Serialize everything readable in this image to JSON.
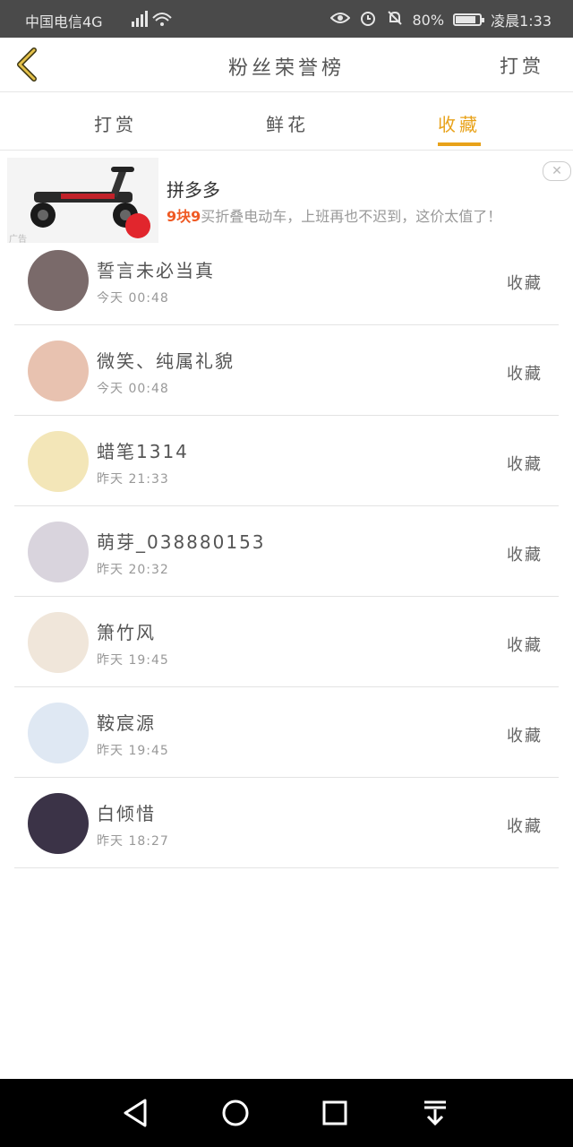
{
  "status_bar": {
    "carrier": "中国电信4G",
    "network": "4G",
    "battery": "80%",
    "time": "凌晨1:33",
    "icons": [
      "signal-icon",
      "wifi-icon",
      "eye-icon",
      "alarm-icon",
      "mute-bell-icon",
      "battery-icon"
    ]
  },
  "header": {
    "title": "粉丝荣誉榜",
    "right_action": "打赏"
  },
  "tabs": [
    {
      "label": "打赏"
    },
    {
      "label": "鲜花"
    },
    {
      "label": "收藏",
      "active": true
    }
  ],
  "ad": {
    "title": "拼多多",
    "highlight": "9块9",
    "desc_rest": "买折叠电动车，上班再也不迟到，这价太值了！",
    "badge": "广告",
    "close": "✕"
  },
  "list": [
    {
      "name": "誓言未必当真",
      "time": "今天 00:48",
      "action": "收藏",
      "avatar_color": "#7a6a6a"
    },
    {
      "name": "微笑、纯属礼貌",
      "time": "今天 00:48",
      "action": "收藏",
      "avatar_color": "#e8c2b0"
    },
    {
      "name": "蜡笔1314",
      "time": "昨天 21:33",
      "action": "收藏",
      "avatar_color": "#f3e6b8"
    },
    {
      "name": "萌芽_038880153",
      "time": "昨天 20:32",
      "action": "收藏",
      "avatar_color": "#d9d4dd"
    },
    {
      "name": "箫竹风",
      "time": "昨天 19:45",
      "action": "收藏",
      "avatar_color": "#f0e6da"
    },
    {
      "name": "鞍宸源",
      "time": "昨天 19:45",
      "action": "收藏",
      "avatar_color": "#dfe8f3"
    },
    {
      "name": "白倾惜",
      "time": "昨天 18:27",
      "action": "收藏",
      "avatar_color": "#3b3347"
    }
  ]
}
